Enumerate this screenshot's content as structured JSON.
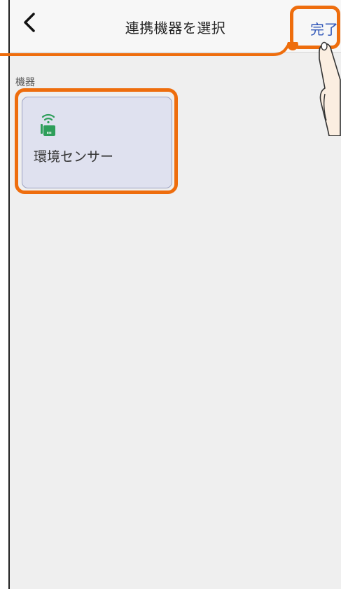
{
  "header": {
    "back_icon": "chevron-left-icon",
    "title": "連携機器を選択",
    "done_label": "完了"
  },
  "section": {
    "label": "機器"
  },
  "devices": [
    {
      "name": "環境センサー",
      "icon": "environment-sensor-icon",
      "selected": true
    }
  ],
  "colors": {
    "accent": "#2f56b8",
    "highlight": "#ee6d0d",
    "card_bg": "#dfe1ef",
    "sensor_green": "#2e9e5a",
    "background": "#efefef"
  }
}
